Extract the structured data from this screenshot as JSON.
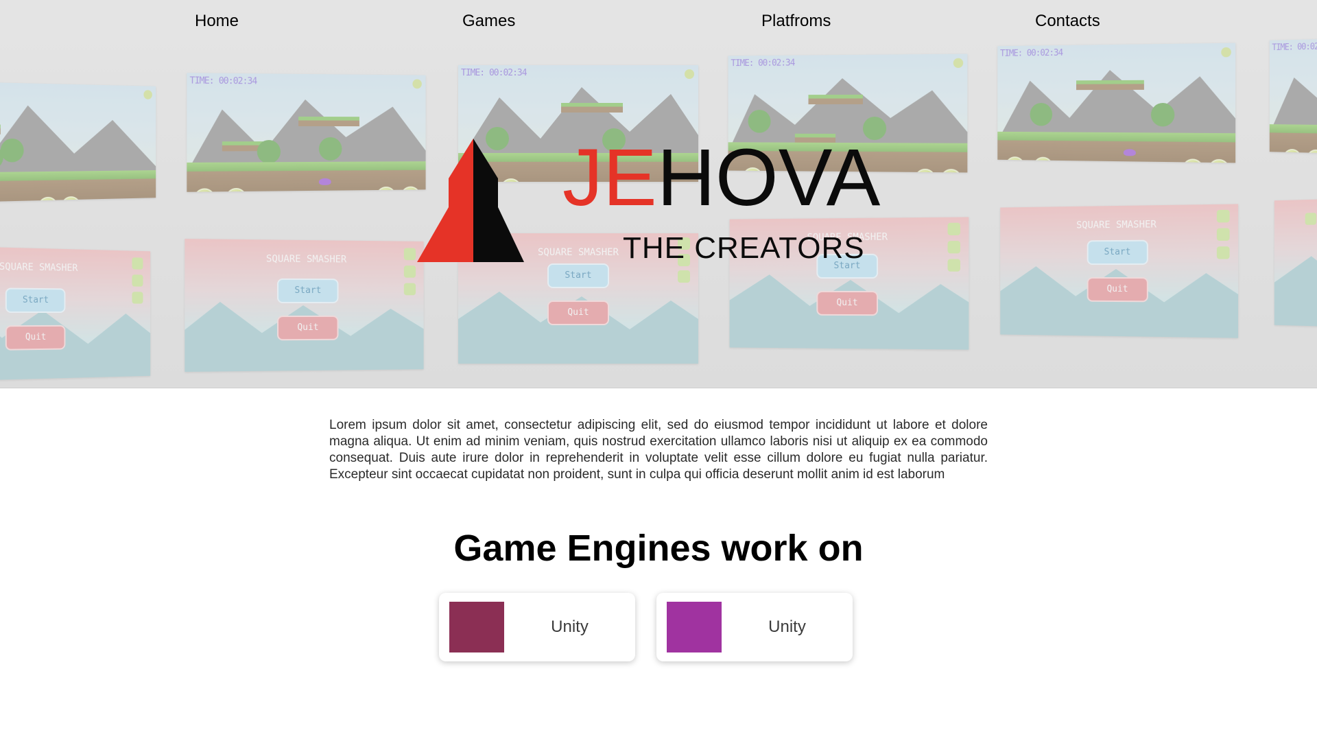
{
  "nav": {
    "items": [
      {
        "label": "Home"
      },
      {
        "label": "Games"
      },
      {
        "label": "Platfroms"
      },
      {
        "label": "Contacts"
      }
    ]
  },
  "hero": {
    "logo": {
      "word_red": "JE",
      "word_dark": "HOVA",
      "tagline": "THE CREATORS",
      "colors": {
        "red": "#e53327",
        "dark": "#0b0b0b"
      }
    },
    "collage": {
      "timer_text": "TIME: 00:02:34",
      "game_title": "SQUARE SMASHER",
      "start_label": "Start",
      "quit_label": "Quit"
    }
  },
  "intro": {
    "text": "Lorem ipsum dolor sit amet, consectetur adipiscing elit, sed do eiusmod tempor incididunt ut labore et dolore magna aliqua. Ut enim ad minim veniam, quis nostrud exercitation ullamco laboris nisi ut aliquip ex ea commodo consequat. Duis aute irure dolor in reprehenderit in voluptate velit esse cillum dolore eu fugiat nulla pariatur. Excepteur sint occaecat cupidatat non proident, sunt in culpa qui officia deserunt mollit anim id est laborum"
  },
  "engines": {
    "title": "Game Engines work on",
    "cards": [
      {
        "label": "Unity",
        "color": "#8b2f54"
      },
      {
        "label": "Unity",
        "color": "#a033a0"
      }
    ]
  }
}
